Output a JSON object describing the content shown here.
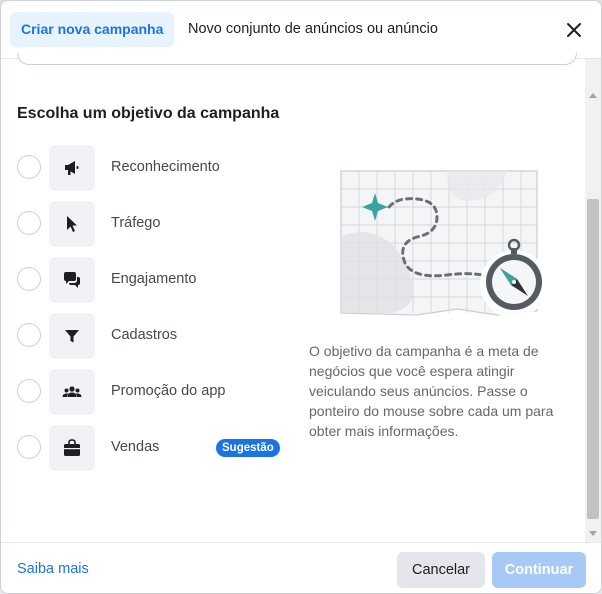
{
  "header": {
    "tabs": [
      {
        "label": "Criar nova campanha",
        "active": true
      },
      {
        "label": "Novo conjunto de anúncios ou anúncio",
        "active": false
      }
    ],
    "close_icon": "close-icon"
  },
  "main": {
    "section_title": "Escolha um objetivo da campanha",
    "objectives": [
      {
        "label": "Reconhecimento",
        "icon": "megaphone-icon"
      },
      {
        "label": "Tráfego",
        "icon": "cursor-icon"
      },
      {
        "label": "Engajamento",
        "icon": "chat-bubbles-icon"
      },
      {
        "label": "Cadastros",
        "icon": "filter-icon"
      },
      {
        "label": "Promoção do app",
        "icon": "people-icon"
      },
      {
        "label": "Vendas",
        "icon": "shopping-bag-icon",
        "badge": "Sugestão"
      }
    ],
    "description": "O objetivo da campanha é a meta de negócios que você espera atingir veiculando seus anúncios. Passe o ponteiro do mouse sobre cada um para obter mais informações.",
    "illustration": "map-compass-illustration"
  },
  "footer": {
    "learn_more": "Saiba mais",
    "cancel_label": "Cancelar",
    "continue_label": "Continuar"
  },
  "colors": {
    "accent": "#1b74e4",
    "accent_light": "#e7f3ff",
    "disabled_button": "#a7c9f5",
    "icon_bg": "#f0f2f5",
    "illustration_teal": "#3aa5a0"
  }
}
